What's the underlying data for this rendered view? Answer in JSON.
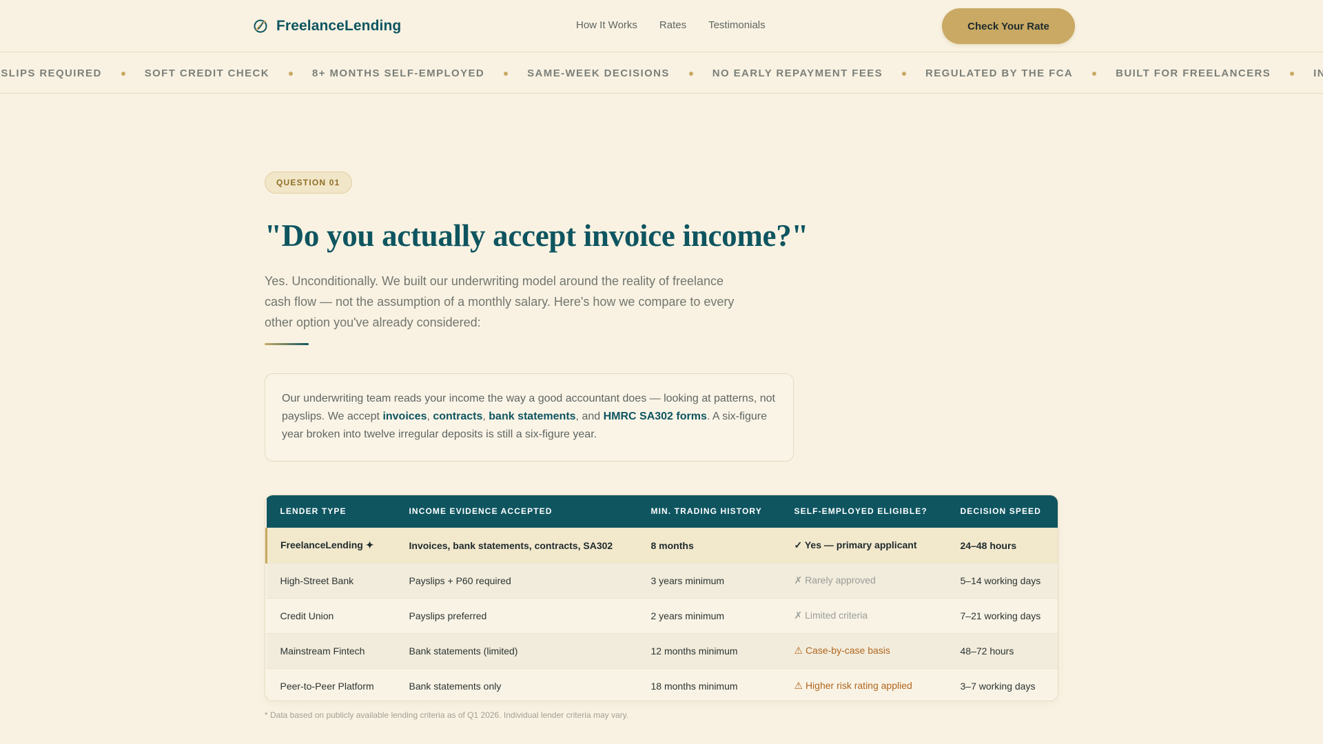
{
  "header": {
    "brand": "FreelanceLending",
    "brand_icon": "leaf-circle-icon",
    "nav": [
      "How It Works",
      "Rates",
      "Testimonials"
    ],
    "cta": "Check Your Rate"
  },
  "ticker": {
    "items": [
      "YSLIPS REQUIRED",
      "SOFT CREDIT CHECK",
      "8+ MONTHS SELF-EMPLOYED",
      "SAME-WEEK DECISIONS",
      "NO EARLY REPAYMENT FEES",
      "REGULATED BY THE FCA",
      "BUILT FOR FREELANCERS",
      "INVOICE IN"
    ]
  },
  "main": {
    "badge": "QUESTION 01",
    "headline": "\"Do you actually accept invoice income?\"",
    "intro": "Yes. Unconditionally. We built our underwriting model around the reality of freelance cash flow — not the assumption of a monthly salary. Here's how we compare to every other option you've already considered:",
    "callout": {
      "pre": "Our underwriting team reads your income the way a good accountant does — looking at patterns, not payslips. We accept ",
      "k1": "invoices",
      "sep1": ", ",
      "k2": "contracts",
      "sep2": ", ",
      "k3": "bank statements",
      "sep3": ", and ",
      "k4": "HMRC SA302 forms",
      "post": ". A six-figure year broken into twelve irregular deposits is still a six-figure year."
    }
  },
  "table": {
    "headers": [
      "LENDER TYPE",
      "INCOME EVIDENCE ACCEPTED",
      "MIN. TRADING HISTORY",
      "SELF-EMPLOYED ELIGIBLE?",
      "DECISION SPEED"
    ],
    "rows": [
      {
        "lender": "FreelanceLending ✦",
        "evidence": "Invoices, bank statements, contracts, SA302",
        "history": "8 months",
        "eligible": "✓ Yes — primary applicant",
        "speed": "24–48 hours"
      },
      {
        "lender": "High-Street Bank",
        "evidence": "Payslips + P60 required",
        "history": "3 years minimum",
        "eligible": "✗ Rarely approved",
        "speed": "5–14 working days"
      },
      {
        "lender": "Credit Union",
        "evidence": "Payslips preferred",
        "history": "2 years minimum",
        "eligible": "✗ Limited criteria",
        "speed": "7–21 working days"
      },
      {
        "lender": "Mainstream Fintech",
        "evidence": "Bank statements (limited)",
        "history": "12 months minimum",
        "eligible": "⚠ Case-by-case basis",
        "speed": "48–72 hours"
      },
      {
        "lender": "Peer-to-Peer Platform",
        "evidence": "Bank statements only",
        "history": "18 months minimum",
        "eligible": "⚠ Higher risk rating applied",
        "speed": "3–7 working days"
      }
    ],
    "footnote": "* Data based on publicly available lending criteria as of Q1 2026. Individual lender criteria may vary."
  },
  "colors": {
    "brand_teal": "#0e5560",
    "accent_gold": "#c9a963",
    "background": "#f9f2e2",
    "warning": "#b0661e"
  }
}
